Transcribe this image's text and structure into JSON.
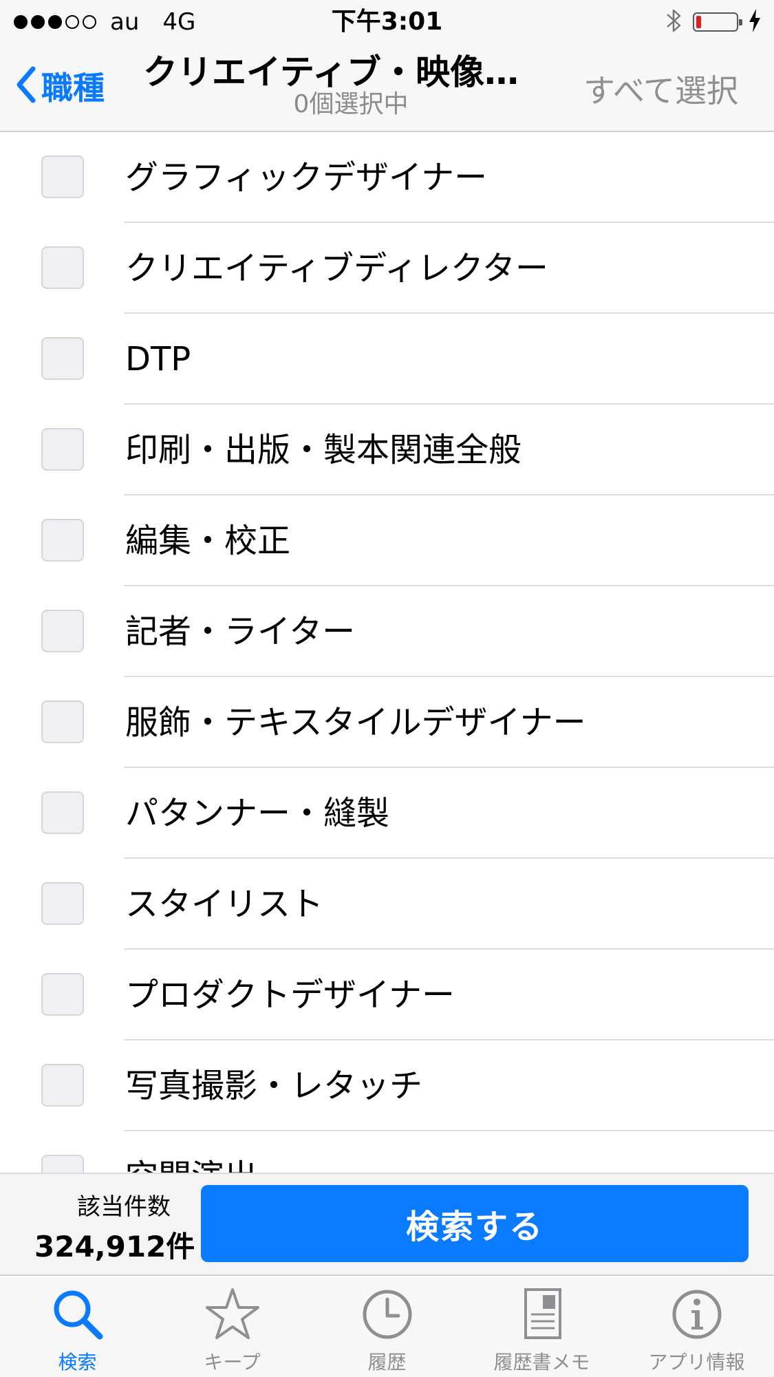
{
  "status_bar": {
    "carrier": "au",
    "network": "4G",
    "time": "下午3:01",
    "signal_bars_filled": 3,
    "signal_bars_total": 5,
    "battery_level": 0.12,
    "icons": [
      "bluetooth-icon",
      "battery-icon",
      "charging-bolt-icon"
    ]
  },
  "nav": {
    "back_label": "職種",
    "title": "クリエイティブ・映像…",
    "subtitle": "0個選択中",
    "select_all": "すべて選択"
  },
  "list": {
    "items": [
      {
        "label": "グラフィックデザイナー",
        "checked": false
      },
      {
        "label": "クリエイティブディレクター",
        "checked": false
      },
      {
        "label": "DTP",
        "checked": false
      },
      {
        "label": "印刷・出版・製本関連全般",
        "checked": false
      },
      {
        "label": "編集・校正",
        "checked": false
      },
      {
        "label": "記者・ライター",
        "checked": false
      },
      {
        "label": "服飾・テキスタイルデザイナー",
        "checked": false
      },
      {
        "label": "パタンナー・縫製",
        "checked": false
      },
      {
        "label": "スタイリスト",
        "checked": false
      },
      {
        "label": "プロダクトデザイナー",
        "checked": false
      },
      {
        "label": "写真撮影・レタッチ",
        "checked": false
      },
      {
        "label": "空間演出",
        "checked": false
      }
    ]
  },
  "footer": {
    "count_label": "該当件数",
    "count_value": "324,912件",
    "search_button": "検索する"
  },
  "tabbar": {
    "items": [
      {
        "label": "検索",
        "icon": "search-icon",
        "active": true
      },
      {
        "label": "キープ",
        "icon": "star-icon",
        "active": false
      },
      {
        "label": "履歴",
        "icon": "clock-icon",
        "active": false
      },
      {
        "label": "履歴書メモ",
        "icon": "document-icon",
        "active": false
      },
      {
        "label": "アプリ情報",
        "icon": "info-icon",
        "active": false
      }
    ]
  },
  "colors": {
    "accent": "#0a7aff",
    "inactive": "#8e8e93",
    "battery_low": "#e02020"
  }
}
